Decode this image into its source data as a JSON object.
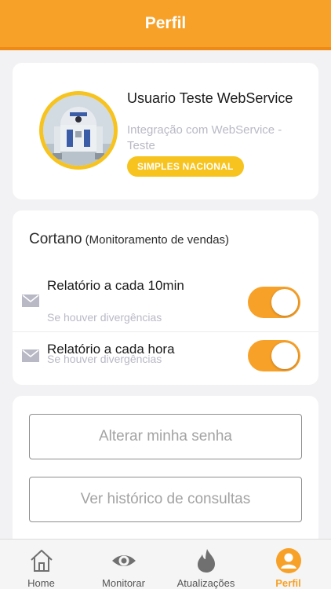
{
  "header": {
    "title": "Perfil"
  },
  "profile": {
    "name": "Usuario Teste WebService",
    "description": "Integração com WebService - Teste",
    "badge": "SIMPLES NACIONAL"
  },
  "cortano": {
    "title": "Cortano",
    "subtitle": "(Monitoramento de vendas)",
    "settings": [
      {
        "label": "Relatório a cada 10min",
        "hint": "Se houver divergências",
        "enabled": true,
        "icon": "mail-icon"
      },
      {
        "label": "Relatório a cada hora",
        "hint": "Se houver divergências",
        "enabled": true,
        "icon": "mail-icon"
      }
    ]
  },
  "actions": {
    "change_password": "Alterar minha senha",
    "history": "Ver histórico de consultas"
  },
  "tabbar": {
    "items": [
      {
        "label": "Home",
        "icon": "home-icon"
      },
      {
        "label": "Monitorar",
        "icon": "eye-icon"
      },
      {
        "label": "Atualizações",
        "icon": "flame-icon"
      },
      {
        "label": "Perfil",
        "icon": "user-circle-icon",
        "active": true
      }
    ]
  },
  "colors": {
    "accent": "#f8a128",
    "badge": "#f7c31e",
    "muted_text": "#b9b9c6"
  }
}
